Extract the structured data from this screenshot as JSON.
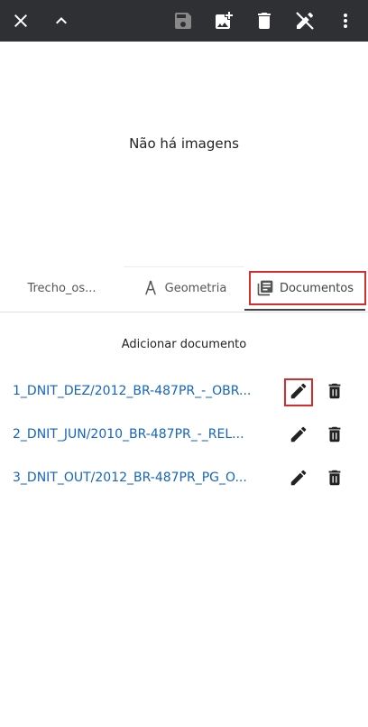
{
  "toolbar": {
    "icons": [
      "close-icon",
      "chevron-up-icon",
      "save-icon",
      "add-photo-icon",
      "delete-icon",
      "edit-off-icon",
      "more-vert-icon"
    ],
    "background": "#2f3034",
    "icon_color": "#ffffff",
    "disabled_icon_color": "#888888"
  },
  "empty_message": "Não há imagens",
  "tabs": [
    {
      "label": "Trecho_os...",
      "icon": null,
      "active": false
    },
    {
      "label": "Geometria",
      "icon": "compass-icon",
      "active": false
    },
    {
      "label": "Documentos",
      "icon": "library-books-icon",
      "active": true
    }
  ],
  "add_document_label": "Adicionar documento",
  "documents": [
    {
      "name": "1_DNIT_DEZ/2012_BR-487PR_-_OBR..."
    },
    {
      "name": "2_DNIT_JUN/2010_BR-487PR_-_REL..."
    },
    {
      "name": "3_DNIT_OUT/2012_BR-487PR_PG_O..."
    }
  ],
  "colors": {
    "link": "#1565c0",
    "highlight": "#d32f2f"
  }
}
